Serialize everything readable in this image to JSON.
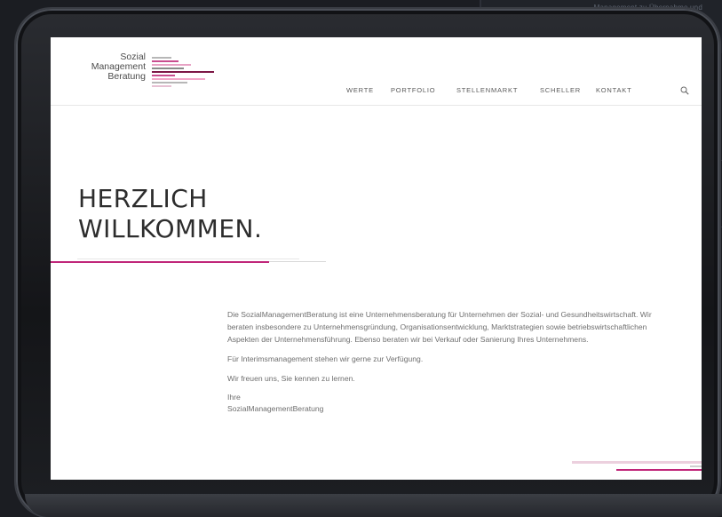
{
  "background_note": "Management zu Übernahme und",
  "logo": {
    "line1": "Sozial",
    "line2": "Management",
    "line3": "Beratung",
    "bar_colors": [
      "#b7b7b7",
      "#c94d8f",
      "#7d1746",
      "#f2a6c8",
      "#8a8a8a",
      "#e7c0d3"
    ]
  },
  "nav": {
    "items": [
      "WERTE",
      "PORTFOLIO",
      "STELLENMARKT",
      "SCHELLER",
      "KONTAKT"
    ],
    "search_icon": "search-icon"
  },
  "hero": {
    "line1": "HERZLICH",
    "line2": "WILLKOMMEN."
  },
  "content": {
    "intro": "Die SozialManagementBeratung ist eine Unternehmensberatung für Unternehmen der Sozial- und Gesundheitswirtschaft. Wir beraten insbesondere zu Unternehmensgründung, Organisationsentwicklung, Marktstrategien sowie betriebswirtschaftlichen Aspekten der Unternehmensführung. Ebenso beraten wir bei Verkauf oder Sanierung Ihres Unternehmens.",
    "interim": "Für Interimsmanagement stehen wir gerne zur Verfügung.",
    "greeting": "Wir freuen uns, Sie kennen zu lernen.",
    "sign_line1": "Ihre",
    "sign_line2": "SozialManagementBeratung"
  },
  "colors": {
    "accent": "#c0267a",
    "accent_light": "#e9c6d8",
    "gray_line": "#cfcfcf",
    "text": "#6f6f6f",
    "heading": "#2d2d2d"
  }
}
